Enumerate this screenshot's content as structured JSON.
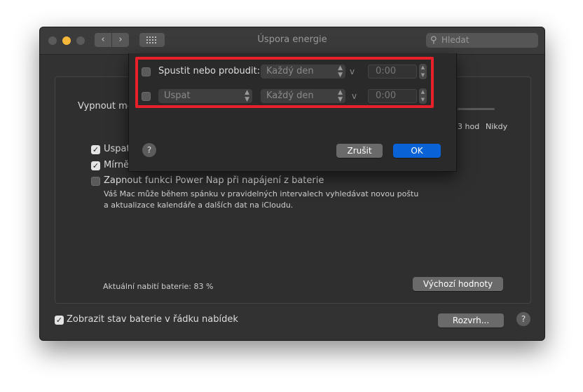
{
  "window": {
    "title": "Úspora energie",
    "search_placeholder": "Hledat",
    "nav_back": "‹",
    "nav_forward": "›"
  },
  "main": {
    "vypnout_label": "Vypnout mo",
    "slider_ticks": [
      "3 hod",
      "Nikdy"
    ],
    "options": [
      {
        "label": "Uspat",
        "checked": true
      },
      {
        "label": "Mírně",
        "checked": true
      },
      {
        "label": "Zapnout funkci Power Nap při napájení z baterie",
        "checked": false
      }
    ],
    "power_nap_description": [
      "Váš Mac může během spánku v pravidelných intervalech vyhledávat novou poštu",
      "a aktualizace kalendáře a dalších dat na iCloudu."
    ],
    "battery_level": "Aktuální nabití baterie: 83 %",
    "defaults_button": "Výchozí hodnoty"
  },
  "footer": {
    "show_battery_label": "Zobrazit stav baterie v řádku nabídek",
    "show_battery_checked": true,
    "schedule_button": "Rozvrh...",
    "help": "?"
  },
  "sheet": {
    "row1": {
      "label": "Spustit nebo probudit:",
      "frequency": "Každý den",
      "v": "v",
      "time": "0:00",
      "checked": false
    },
    "row2": {
      "action": "Uspat",
      "frequency": "Každý den",
      "v": "v",
      "time": "0:00",
      "checked": false
    },
    "help": "?",
    "cancel": "Zrušit",
    "ok": "OK"
  },
  "colors": {
    "accent": "#0a63d6",
    "highlight": "#e8202a",
    "minimize": "#f5b83a"
  }
}
